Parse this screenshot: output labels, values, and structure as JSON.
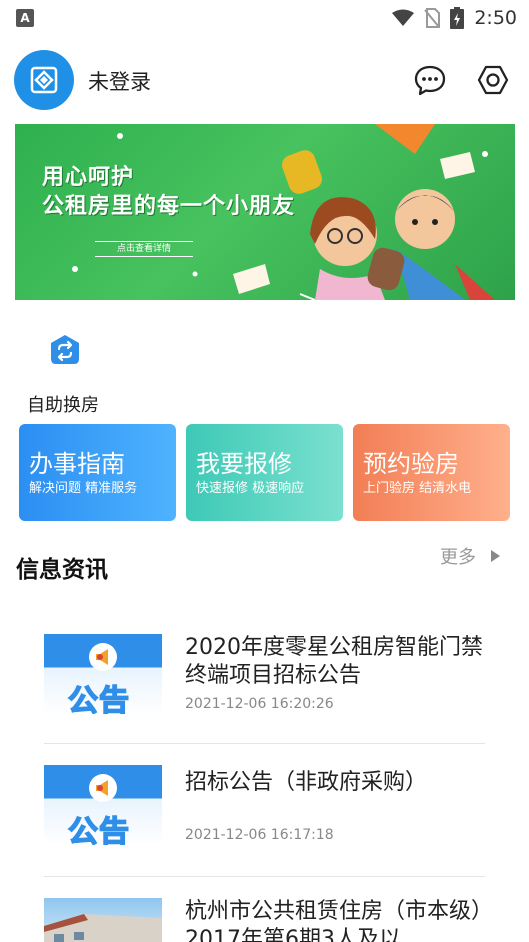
{
  "status_bar": {
    "time": "2:50",
    "app_indicator": "A"
  },
  "header": {
    "login_status": "未登录",
    "chat_icon": "chat-bubble-icon",
    "settings_icon": "hexagon-settings-icon"
  },
  "banner": {
    "line1": "用心呵护",
    "line2": "公租房里的每一个小朋友",
    "cta": "点击查看详情"
  },
  "self_service": {
    "label": "自助换房",
    "icon": "swap-icon"
  },
  "cards": [
    {
      "title": "办事指南",
      "subtitle": "解决问题 精准服务"
    },
    {
      "title": "我要报修",
      "subtitle": "快速报修 极速响应"
    },
    {
      "title": "预约验房",
      "subtitle": "上门验房 结清水电"
    }
  ],
  "news": {
    "section_title": "信息资讯",
    "more_label": "更多",
    "items": [
      {
        "title": "2020年度零星公租房智能门禁终端项目招标公告",
        "date": "2021-12-06 16:20:26",
        "thumb_text": "公告"
      },
      {
        "title": "招标公告（非政府采购）",
        "date": "2021-12-06 16:17:18",
        "thumb_text": "公告"
      },
      {
        "title": "杭州市公共租赁住房（市本级）2017年第6期3人及以",
        "date": ""
      }
    ]
  },
  "colors": {
    "brand_blue": "#1f90e6",
    "card_blue": "#2b8ef2",
    "card_teal": "#3dc9b6",
    "card_orange": "#f27e55",
    "banner_green": "#2fb04f"
  }
}
